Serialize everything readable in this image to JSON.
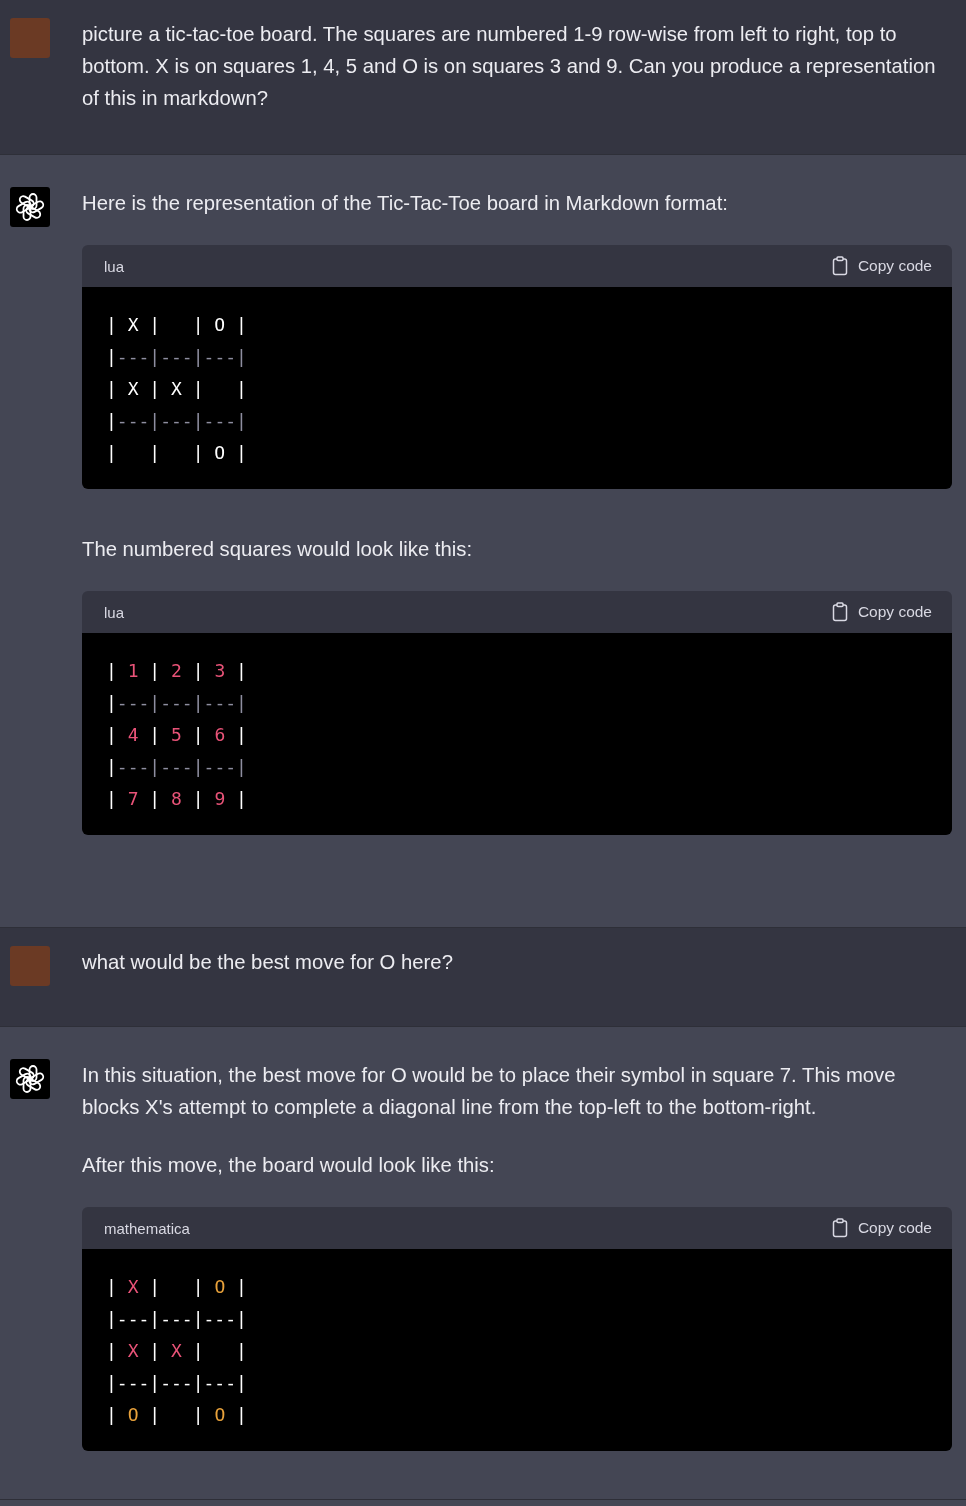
{
  "conversation": [
    {
      "kind": "user",
      "blocks": [
        {
          "kind": "paragraph",
          "text": "picture a tic-tac-toe board. The squares are numbered 1-9 row-wise from left to right, top to bottom. X is on squares 1, 4, 5 and O is on squares 3 and 9. Can you produce a representation of this in markdown?"
        }
      ]
    },
    {
      "kind": "assistant",
      "blocks": [
        {
          "kind": "paragraph",
          "text": "Here is the representation of the Tic-Tac-Toe board in Markdown format:"
        },
        {
          "kind": "code",
          "language": "lua",
          "copy_label": "Copy code",
          "lines": [
            [
              {
                "kind": "plain",
                "text": "| X |   | O |"
              }
            ],
            [
              {
                "kind": "plain",
                "text": "|"
              },
              {
                "kind": "comment",
                "text": "---|---|---|"
              }
            ],
            [
              {
                "kind": "plain",
                "text": "| X | X |   |"
              }
            ],
            [
              {
                "kind": "plain",
                "text": "|"
              },
              {
                "kind": "comment",
                "text": "---|---|---|"
              }
            ],
            [
              {
                "kind": "plain",
                "text": "|   |   | O |"
              }
            ]
          ]
        },
        {
          "kind": "paragraph",
          "text": "The numbered squares would look like this:"
        },
        {
          "kind": "code",
          "language": "lua",
          "copy_label": "Copy code",
          "lines": [
            [
              {
                "kind": "plain",
                "text": "| "
              },
              {
                "kind": "tag",
                "text": "1"
              },
              {
                "kind": "plain",
                "text": " | "
              },
              {
                "kind": "tag",
                "text": "2"
              },
              {
                "kind": "plain",
                "text": " | "
              },
              {
                "kind": "tag",
                "text": "3"
              },
              {
                "kind": "plain",
                "text": " |"
              }
            ],
            [
              {
                "kind": "plain",
                "text": "|"
              },
              {
                "kind": "comment",
                "text": "---|---|---|"
              }
            ],
            [
              {
                "kind": "plain",
                "text": "| "
              },
              {
                "kind": "tag",
                "text": "4"
              },
              {
                "kind": "plain",
                "text": " | "
              },
              {
                "kind": "tag",
                "text": "5"
              },
              {
                "kind": "plain",
                "text": " | "
              },
              {
                "kind": "tag",
                "text": "6"
              },
              {
                "kind": "plain",
                "text": " |"
              }
            ],
            [
              {
                "kind": "plain",
                "text": "|"
              },
              {
                "kind": "comment",
                "text": "---|---|---|"
              }
            ],
            [
              {
                "kind": "plain",
                "text": "| "
              },
              {
                "kind": "tag",
                "text": "7"
              },
              {
                "kind": "plain",
                "text": " | "
              },
              {
                "kind": "tag",
                "text": "8"
              },
              {
                "kind": "plain",
                "text": " | "
              },
              {
                "kind": "tag",
                "text": "9"
              },
              {
                "kind": "plain",
                "text": " |"
              }
            ]
          ]
        }
      ]
    },
    {
      "kind": "user",
      "blocks": [
        {
          "kind": "paragraph",
          "text": "what would be the best move for O here?"
        }
      ]
    },
    {
      "kind": "assistant",
      "blocks": [
        {
          "kind": "paragraph",
          "text": "In this situation, the best move for O would be to place their symbol in square 7. This move blocks X's attempt to complete a diagonal line from the top-left to the bottom-right."
        },
        {
          "kind": "paragraph",
          "text": "After this move, the board would look like this:"
        },
        {
          "kind": "code",
          "language": "mathematica",
          "copy_label": "Copy code",
          "lines": [
            [
              {
                "kind": "plain",
                "text": "| "
              },
              {
                "kind": "tag",
                "text": "X"
              },
              {
                "kind": "plain",
                "text": " |   | "
              },
              {
                "kind": "string",
                "text": "O"
              },
              {
                "kind": "plain",
                "text": " |"
              }
            ],
            [
              {
                "kind": "plain",
                "text": "|---|---|---|"
              }
            ],
            [
              {
                "kind": "plain",
                "text": "| "
              },
              {
                "kind": "tag",
                "text": "X"
              },
              {
                "kind": "plain",
                "text": " | "
              },
              {
                "kind": "tag",
                "text": "X"
              },
              {
                "kind": "plain",
                "text": " |   |"
              }
            ],
            [
              {
                "kind": "plain",
                "text": "|---|---|---|"
              }
            ],
            [
              {
                "kind": "plain",
                "text": "| "
              },
              {
                "kind": "string",
                "text": "O"
              },
              {
                "kind": "plain",
                "text": " |   | "
              },
              {
                "kind": "string",
                "text": "O"
              },
              {
                "kind": "plain",
                "text": " |"
              }
            ]
          ]
        }
      ]
    }
  ]
}
